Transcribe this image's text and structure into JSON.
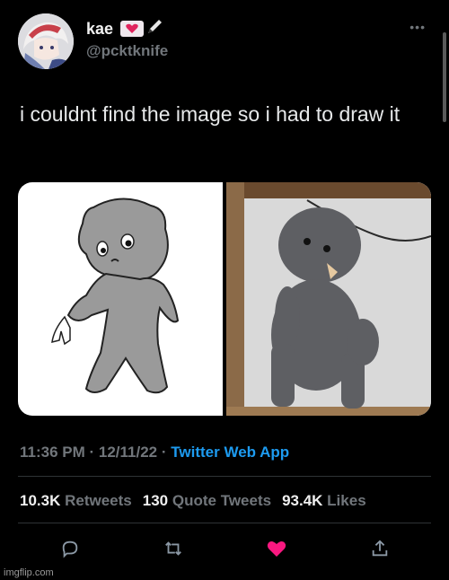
{
  "user": {
    "display_name": "kae",
    "handle": "@pcktknife"
  },
  "tweet": {
    "text": "i couldnt find the image so i had to draw it"
  },
  "meta": {
    "time": "11:36 PM",
    "date": "12/11/22",
    "app": "Twitter Web App"
  },
  "stats": [
    {
      "count": "10.3K",
      "label": "Retweets"
    },
    {
      "count": "130",
      "label": "Quote Tweets"
    },
    {
      "count": "93.4K",
      "label": "Likes"
    }
  ],
  "actions": [
    "reply-icon",
    "retweet-icon",
    "like-icon",
    "share-icon"
  ],
  "colors": {
    "link": "#1d9bf0",
    "like": "#f91880",
    "muted": "#71767b"
  },
  "watermark": "imgflip.com"
}
